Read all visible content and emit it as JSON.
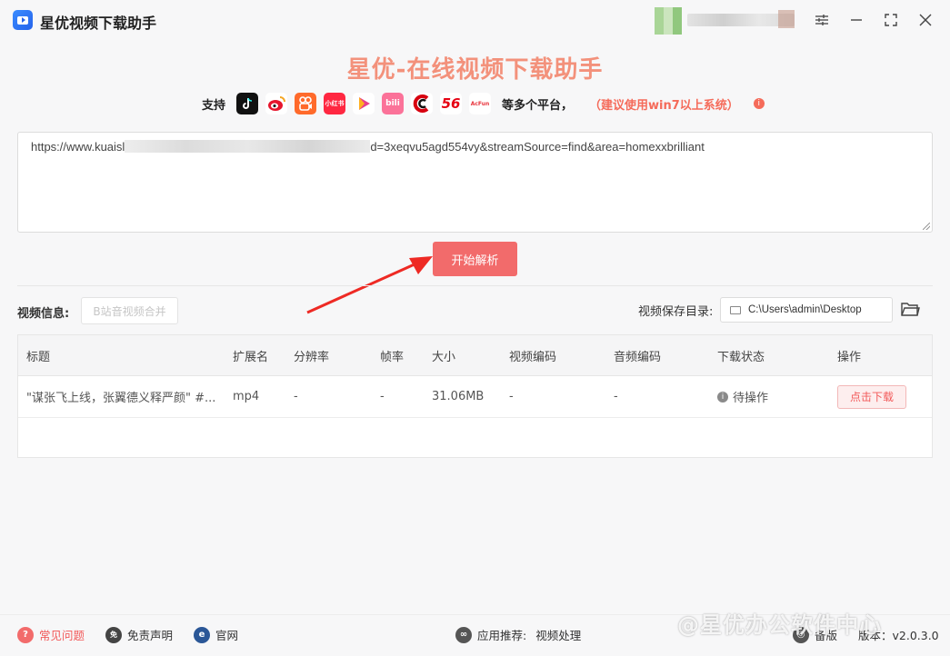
{
  "app": {
    "title": "星优视频下载助手"
  },
  "header": {
    "heading": "星优-在线视频下载助手",
    "support_label": "支持",
    "platforms": [
      {
        "name": "douyin-icon",
        "label": "",
        "bg": "#111111"
      },
      {
        "name": "weibo-icon",
        "label": "",
        "bg": "#ffffff"
      },
      {
        "name": "kuaishou-icon",
        "label": "",
        "bg": "#ff6a2b"
      },
      {
        "name": "xiaohongshu-icon",
        "label": "小红书",
        "bg": "#ff2741"
      },
      {
        "name": "play-icon",
        "label": "",
        "bg": "#ffffff"
      },
      {
        "name": "bilibili-icon",
        "label": "bili",
        "bg": "#fb7299"
      },
      {
        "name": "cntv-icon",
        "label": "",
        "bg": "#ffffff"
      },
      {
        "name": "56-icon",
        "label": "56",
        "bg": "#ffffff"
      },
      {
        "name": "acfun-icon",
        "label": "AcFun",
        "bg": "#ffffff"
      }
    ],
    "more_text": "等多个平台，",
    "tip": "（建议使用win7以上系统）"
  },
  "url_input": {
    "prefix": "https://www.kuaisl",
    "suffix": "d=3xeqvu5agd554vy&streamSource=find&area=homexxbrilliant"
  },
  "parse_button": "开始解析",
  "video_info": {
    "label": "视频信息:",
    "merge_button": "B站音视频合并",
    "save_label": "视频保存目录:",
    "save_path": "C:\\Users\\admin\\Desktop"
  },
  "table": {
    "headers": [
      "标题",
      "扩展名",
      "分辨率",
      "帧率",
      "大小",
      "视频编码",
      "音频编码",
      "下载状态",
      "操作"
    ],
    "rows": [
      {
        "title": "\"谋张飞上线，张翼德义释严颜\" #...",
        "ext": "mp4",
        "resolution": "-",
        "fps": "-",
        "size": "31.06MB",
        "vcodec": "-",
        "acodec": "-",
        "status": "待操作",
        "action": "点击下载"
      }
    ]
  },
  "footer": {
    "faq": "常见问题",
    "disclaimer": "免责声明",
    "website": "官网",
    "recommend_label": "应用推荐:",
    "recommend_value": "视频处理",
    "backup": "备版",
    "version": "版本：v2.0.3.0"
  },
  "watermark": "@星优办公软件中心",
  "colors": {
    "accent": "#f26b6b",
    "heading": "#f3917b",
    "tip": "#f56b5a"
  }
}
